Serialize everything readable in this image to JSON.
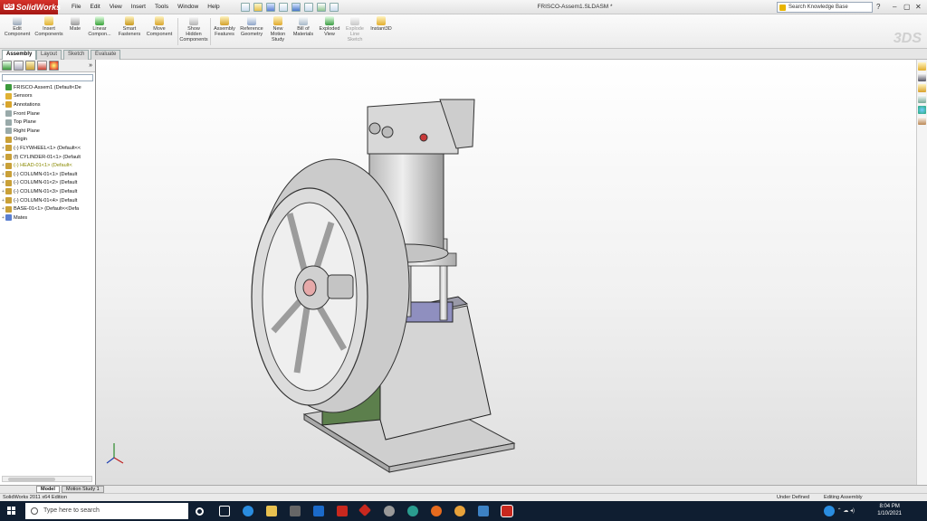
{
  "app": {
    "name": "SolidWorks",
    "doc_title": "FRISCO-Assem1.SLDASM *"
  },
  "menu": [
    "File",
    "Edit",
    "View",
    "Insert",
    "Tools",
    "Window",
    "Help"
  ],
  "search_kb": {
    "placeholder": "Search Knowledge Base"
  },
  "commands": [
    {
      "label": "Edit Component",
      "icon": "edit-component-icon"
    },
    {
      "label": "Insert Components",
      "icon": "insert-components-icon"
    },
    {
      "label": "Mate",
      "icon": "mate-icon"
    },
    {
      "label": "Linear Compon...",
      "icon": "linear-pattern-icon"
    },
    {
      "label": "Smart Fasteners",
      "icon": "smart-fasteners-icon"
    },
    {
      "label": "Move Component",
      "icon": "move-component-icon"
    },
    {
      "label": "Show Hidden Components",
      "icon": "show-hidden-icon"
    },
    {
      "label": "Assembly Features",
      "icon": "assembly-features-icon"
    },
    {
      "label": "Reference Geometry",
      "icon": "reference-geometry-icon"
    },
    {
      "label": "New Motion Study",
      "icon": "motion-study-icon"
    },
    {
      "label": "Bill of Materials",
      "icon": "bom-icon"
    },
    {
      "label": "Exploded View",
      "icon": "exploded-view-icon"
    },
    {
      "label": "Explode Line Sketch",
      "icon": "explode-line-icon"
    },
    {
      "label": "Instant3D",
      "icon": "instant3d-icon"
    }
  ],
  "cm_tabs": [
    "Assembly",
    "Layout",
    "Sketch",
    "Evaluate"
  ],
  "tree": [
    {
      "label": "FRISCO-Assem1  (Default<De",
      "expand": ""
    },
    {
      "label": "Sensors",
      "expand": ""
    },
    {
      "label": "Annotations",
      "expand": "+"
    },
    {
      "label": "Front Plane",
      "expand": ""
    },
    {
      "label": "Top Plane",
      "expand": ""
    },
    {
      "label": "Right Plane",
      "expand": ""
    },
    {
      "label": "Origin",
      "expand": ""
    },
    {
      "label": "(-) FLYWHEEL<1>  (Default<<",
      "expand": "+"
    },
    {
      "label": "(f) CYLINDER-01<1>  (Default",
      "expand": "+"
    },
    {
      "label": "(-) HEAD-01<1>  (Default<",
      "expand": "+"
    },
    {
      "label": "(-) COLUMN-01<1>  (Default",
      "expand": "+"
    },
    {
      "label": "(-) COLUMN-01<2>  (Default",
      "expand": "+"
    },
    {
      "label": "(-) COLUMN-01<3>  (Default",
      "expand": "+"
    },
    {
      "label": "(-) COLUMN-01<4>  (Default",
      "expand": "+"
    },
    {
      "label": "BASE-01<1>  (Default<<Defa",
      "expand": "+"
    },
    {
      "label": "Mates",
      "expand": "+"
    }
  ],
  "bottom_tabs": [
    "Model",
    "Motion Study 1"
  ],
  "status": {
    "edition": "SolidWorks 2011 x64 Edition",
    "state": "Under Defined",
    "mode": "Editing Assembly"
  },
  "taskbar": {
    "search_placeholder": "Type here to search",
    "time": "8:04 PM",
    "date": "1/10/2021"
  }
}
